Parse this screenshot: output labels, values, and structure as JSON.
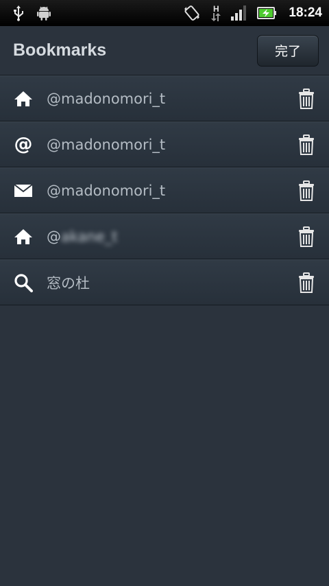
{
  "statusbar": {
    "time": "18:24",
    "network_label": "H",
    "icons": [
      "usb-icon",
      "android-debug-icon",
      "rotate-icon",
      "data-network-icon",
      "signal-icon",
      "battery-charging-icon"
    ]
  },
  "header": {
    "title": "Bookmarks",
    "done_label": "完了"
  },
  "bookmarks": [
    {
      "icon": "home-icon",
      "label": "@madonomori_t"
    },
    {
      "icon": "mention-icon",
      "label": "@madonomori_t"
    },
    {
      "icon": "mail-icon",
      "label": "@madonomori_t"
    },
    {
      "icon": "home-icon",
      "label_prefix": "@",
      "label_redacted": "akane_t"
    },
    {
      "icon": "search-icon",
      "label": "窓の杜"
    }
  ],
  "colors": {
    "background": "#2b333d",
    "statusbar": "#000000",
    "battery_accent": "#4ecb2f"
  }
}
